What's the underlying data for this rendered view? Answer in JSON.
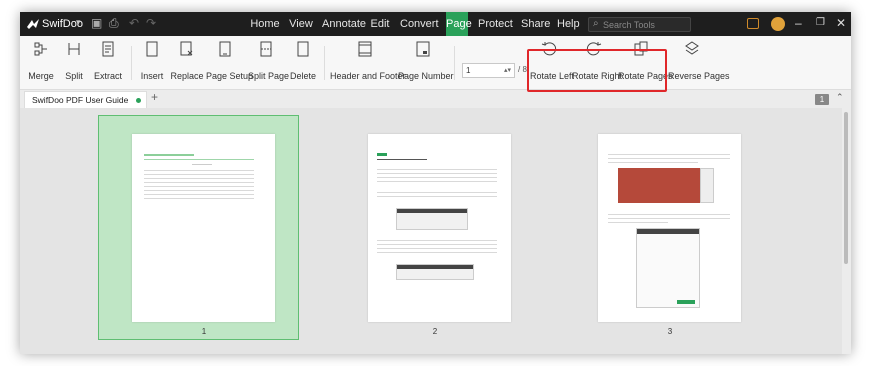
{
  "app": {
    "name": "SwifDoo"
  },
  "menu": [
    {
      "label": "Home"
    },
    {
      "label": "View"
    },
    {
      "label": "Annotate"
    },
    {
      "label": "Edit"
    },
    {
      "label": "Convert"
    },
    {
      "label": "Page",
      "active": true
    },
    {
      "label": "Protect"
    },
    {
      "label": "Share"
    },
    {
      "label": "Help"
    }
  ],
  "search": {
    "placeholder": "Search Tools"
  },
  "toolbar": {
    "merge": "Merge",
    "split": "Split",
    "extract": "Extract",
    "insert": "Insert",
    "replace": "Replace",
    "page_setup": "Page Setup",
    "split_page": "Split Page",
    "delete": "Delete",
    "header_footer": "Header and Footer",
    "page_number": "Page Number",
    "page_input": "1",
    "page_total": "/ 8",
    "rotate_left": "Rotate Left",
    "rotate_right": "Rotate Right",
    "rotate_pages": "Rotate Pages",
    "reverse_pages": "Reverse Pages"
  },
  "tabs": {
    "doc_title": "SwifDoo PDF User Guide",
    "count_badge": "1"
  },
  "thumbnails": [
    {
      "number": "1",
      "selected": true
    },
    {
      "number": "2",
      "selected": false
    },
    {
      "number": "3",
      "selected": false
    }
  ],
  "colors": {
    "accent": "#2aa15a",
    "highlight": "#e0272a",
    "titlebar": "#1e1e1e"
  }
}
